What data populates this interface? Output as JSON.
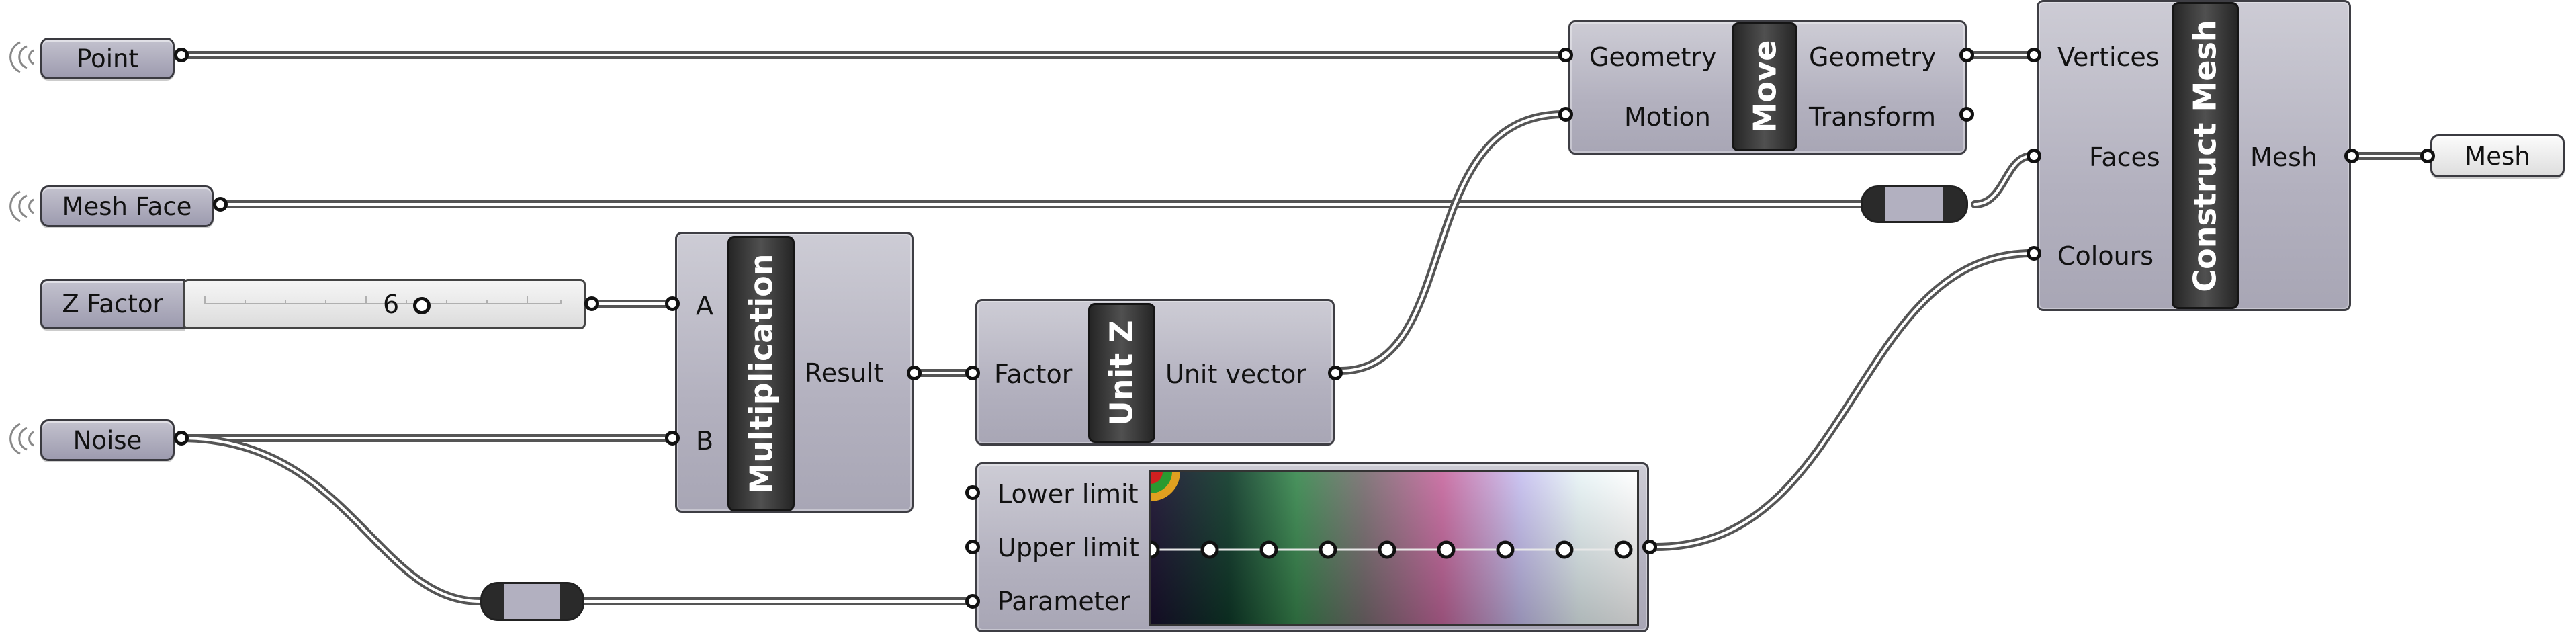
{
  "params": {
    "point": "Point",
    "mesh_face": "Mesh Face",
    "noise": "Noise",
    "mesh_out": "Mesh"
  },
  "slider": {
    "label": "Z Factor",
    "value": "6"
  },
  "move": {
    "title": "Move",
    "inputs": [
      "Geometry",
      "Motion"
    ],
    "outputs": [
      "Geometry",
      "Transform"
    ]
  },
  "construct_mesh": {
    "title": "Construct Mesh",
    "inputs": [
      "Vertices",
      "Faces",
      "Colours"
    ],
    "outputs": [
      "Mesh"
    ]
  },
  "multiplication": {
    "title": "Multiplication",
    "inputs": [
      "A",
      "B"
    ],
    "outputs": [
      "Result"
    ]
  },
  "unit_z": {
    "title": "Unit Z",
    "inputs": [
      "Factor"
    ],
    "outputs": [
      "Unit vector"
    ]
  },
  "gradient": {
    "inputs": [
      "Lower limit",
      "Upper limit",
      "Parameter"
    ],
    "stops": 9
  },
  "colors": {
    "wire": "#555555",
    "component": "#b3b1bf",
    "title_bg": "#262626"
  }
}
